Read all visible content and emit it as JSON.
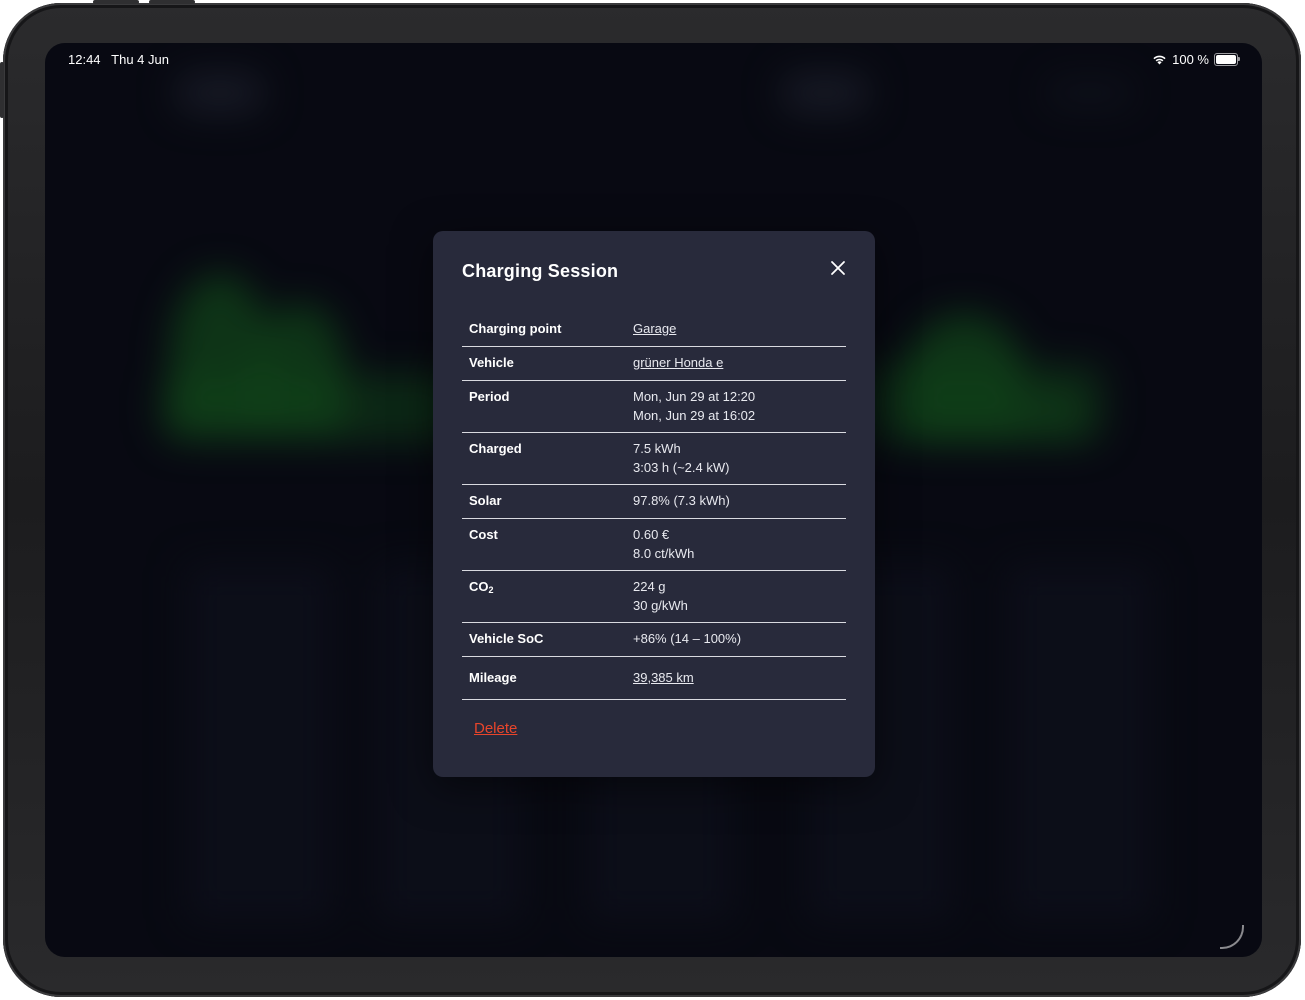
{
  "status_bar": {
    "time": "12:44",
    "date": "Thu 4 Jun",
    "battery": "100 %",
    "battery_level": 1.0
  },
  "modal": {
    "title": "Charging Session",
    "close_icon": "close-icon",
    "rows": {
      "charging_point": {
        "label": "Charging point",
        "value": "Garage"
      },
      "vehicle": {
        "label": "Vehicle",
        "value": "grüner Honda e"
      },
      "period": {
        "label": "Period",
        "start": "Mon, Jun 29 at 12:20",
        "end": "Mon, Jun 29 at 16:02"
      },
      "charged": {
        "label": "Charged",
        "energy": "7.5 kWh",
        "duration": "3:03 h (~2.4 kW)"
      },
      "solar": {
        "label": "Solar",
        "value": "97.8% (7.3 kWh)"
      },
      "cost": {
        "label": "Cost",
        "total": "0.60 €",
        "per_kwh": "8.0 ct/kWh"
      },
      "co2": {
        "label_main": "CO",
        "label_sub": "2",
        "total": "224 g",
        "per_kwh": "30 g/kWh"
      },
      "vehicle_soc": {
        "label": "Vehicle SoC",
        "value": "+86% (14 – 100%)"
      },
      "mileage": {
        "label": "Mileage",
        "value": "39,385 km"
      }
    },
    "delete_label": "Delete"
  },
  "colors": {
    "modal_bg": "#282a3b",
    "screen_bg": "#0b0c16",
    "delete": "#e8452b",
    "divider": "#d9dae0"
  }
}
